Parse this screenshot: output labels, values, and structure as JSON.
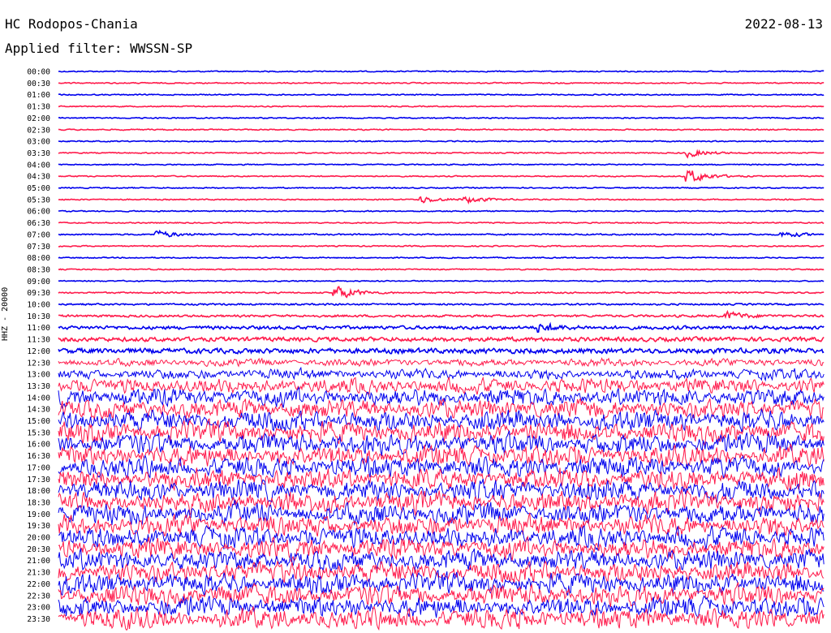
{
  "header": {
    "station": "HC Rodopos-Chania",
    "date": "2022-08-13",
    "filter": "Applied filter: WWSSN-SP",
    "channel": "HHZ - 20000"
  },
  "colors": {
    "odd_rows": "#0000ee",
    "even_rows": "#ff1a4b",
    "background": "#ffffff"
  },
  "chart_data": {
    "type": "line",
    "title": "HC Rodopos-Chania",
    "date": "2022-08-13",
    "filter": "WWSSN-SP",
    "channel": "HHZ - 20000",
    "row_labels": [
      "00:00",
      "00:30",
      "01:00",
      "01:30",
      "02:00",
      "02:30",
      "03:00",
      "03:30",
      "04:00",
      "04:30",
      "05:00",
      "05:30",
      "06:00",
      "06:30",
      "07:00",
      "07:30",
      "08:00",
      "08:30",
      "09:00",
      "09:30",
      "10:00",
      "10:30",
      "11:00",
      "11:30",
      "12:00",
      "12:30",
      "13:00",
      "13:30",
      "14:00",
      "14:30",
      "15:00",
      "15:30",
      "16:00",
      "16:30",
      "17:00",
      "17:30",
      "18:00",
      "18:30",
      "19:00",
      "19:30",
      "20:00",
      "20:30",
      "21:00",
      "21:30",
      "22:00",
      "22:30",
      "23:00",
      "23:30"
    ],
    "row_colors": [
      "blue",
      "red"
    ],
    "relative_noise_amplitude": [
      0.4,
      0.4,
      0.4,
      0.4,
      0.4,
      0.4,
      0.4,
      0.4,
      0.4,
      0.4,
      0.4,
      0.4,
      0.4,
      0.4,
      0.5,
      0.4,
      0.4,
      0.4,
      0.4,
      0.5,
      0.6,
      0.8,
      1.2,
      1.5,
      1.8,
      2.5,
      3.5,
      5,
      6,
      6.5,
      7,
      7,
      7,
      7,
      7,
      7,
      7,
      7,
      7,
      7,
      7,
      7,
      7,
      7,
      7,
      7,
      7,
      7
    ],
    "events": [
      {
        "row": "03:30",
        "x_minutes": 24.8,
        "amplitude": 2.5
      },
      {
        "row": "04:30",
        "x_minutes": 24.8,
        "amplitude": 4.5
      },
      {
        "row": "05:30",
        "x_minutes": 14.3,
        "amplitude": 2.2
      },
      {
        "row": "05:30",
        "x_minutes": 16.1,
        "amplitude": 2.0
      },
      {
        "row": "07:00",
        "x_minutes": 4.0,
        "amplitude": 2.2
      },
      {
        "row": "07:00",
        "x_minutes": 28.5,
        "amplitude": 1.8
      },
      {
        "row": "09:30",
        "x_minutes": 11.0,
        "amplitude": 4.5
      },
      {
        "row": "10:30",
        "x_minutes": 26.3,
        "amplitude": 2.5
      },
      {
        "row": "11:00",
        "x_minutes": 19.0,
        "amplitude": 2.5
      }
    ]
  }
}
